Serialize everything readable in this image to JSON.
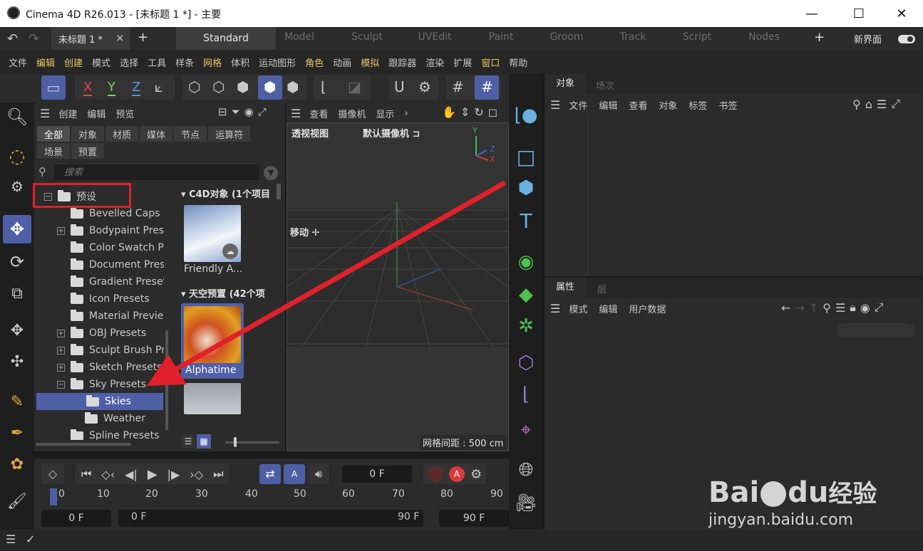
{
  "window": {
    "title": "Cinema 4D R26.013 - [未标题 1 *] - 主要",
    "min": "—",
    "max": "☐",
    "close": "✕"
  },
  "doc_tab": {
    "label": "未标题 1 *",
    "close": "×",
    "add": "+"
  },
  "layouts": [
    "Standard",
    "Model",
    "Sculpt",
    "UVEdit",
    "Paint",
    "Groom",
    "Track",
    "Script",
    "Nodes"
  ],
  "layout_add": "+",
  "new_ui": "新界面",
  "menu": [
    {
      "label": "文件",
      "hl": false
    },
    {
      "label": "编辑",
      "hl": true
    },
    {
      "label": "创建",
      "hl": true
    },
    {
      "label": "模式",
      "hl": false
    },
    {
      "label": "选择",
      "hl": false
    },
    {
      "label": "工具",
      "hl": false
    },
    {
      "label": "样条",
      "hl": false
    },
    {
      "label": "网格",
      "hl": true
    },
    {
      "label": "体积",
      "hl": false
    },
    {
      "label": "运动图形",
      "hl": false
    },
    {
      "label": "角色",
      "hl": true
    },
    {
      "label": "动画",
      "hl": false
    },
    {
      "label": "模拟",
      "hl": true
    },
    {
      "label": "跟踪器",
      "hl": false
    },
    {
      "label": "渲染",
      "hl": false
    },
    {
      "label": "扩展",
      "hl": false
    },
    {
      "label": "窗口",
      "hl": true
    },
    {
      "label": "帮助",
      "hl": false
    }
  ],
  "axis": {
    "x": "X",
    "y": "Y",
    "z": "Z"
  },
  "browser": {
    "toolbar": [
      "创建",
      "编辑",
      "预览"
    ],
    "tabs_row1": [
      "全部",
      "对象",
      "材质",
      "媒体",
      "节点",
      "运算符"
    ],
    "tabs_row2": [
      "场景",
      "预置"
    ],
    "search_placeholder": "搜索",
    "tree_root": "预设",
    "tree": [
      {
        "label": "Bevelled Caps P",
        "expand": false
      },
      {
        "label": "Bodypaint Prese",
        "expand": true
      },
      {
        "label": "Color Swatch Pr",
        "expand": false
      },
      {
        "label": "Document Prese",
        "expand": false
      },
      {
        "label": "Gradient Presets",
        "expand": false
      },
      {
        "label": "Icon Presets",
        "expand": false
      },
      {
        "label": "Material Preview",
        "expand": false
      },
      {
        "label": "OBJ Presets",
        "expand": true
      },
      {
        "label": "Sculpt Brush Pre",
        "expand": true
      },
      {
        "label": "Sketch Presets",
        "expand": true
      },
      {
        "label": "Sky Presets",
        "expand": true
      }
    ],
    "sky_children": [
      "Skies",
      "Weather"
    ],
    "tree_last": "Spline Presets",
    "group1": "C4D对象 (1个项目",
    "item1": "Friendly A...",
    "group2": "天空预置 (42个项",
    "item2": "Alphatime"
  },
  "viewport": {
    "menu": [
      "查看",
      "摄像机",
      "显示"
    ],
    "name": "透视视图",
    "camera": "默认摄像机",
    "move": "移动",
    "grid": "网格间距 : 500 cm",
    "axis_y": "Y",
    "axis_z": "Z",
    "axis_x": "X"
  },
  "objects": {
    "tabs": [
      "对象",
      "场次"
    ],
    "menu": [
      "文件",
      "编辑",
      "查看",
      "对象",
      "标签",
      "书签"
    ]
  },
  "attributes": {
    "tabs": [
      "属性",
      "层"
    ],
    "menu": [
      "模式",
      "编辑",
      "用户数据"
    ]
  },
  "timeline": {
    "frame": "0 F",
    "ticks": [
      "0",
      "10",
      "20",
      "30",
      "40",
      "50",
      "60",
      "70",
      "80",
      "90"
    ],
    "start": "0 F",
    "range_start": "0 F",
    "range_end": "90 F",
    "end": "90 F"
  },
  "watermark": {
    "brand": "Bai",
    "brand2": "du",
    "suffix": "经验",
    "url": "jingyan.baidu.com"
  },
  "colors": {
    "accent": "#4e5fa6",
    "highlight": "#e6c566",
    "arrow": "#e0202a"
  }
}
